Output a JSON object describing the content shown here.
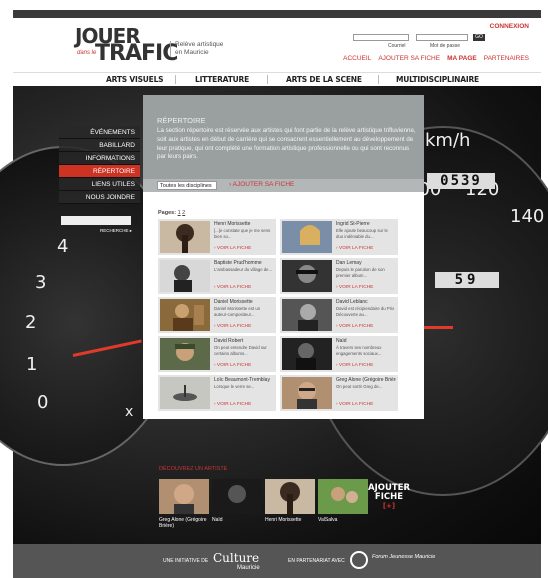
{
  "header": {
    "logo_top": "JOUER",
    "logo_small": "dans le",
    "logo_bottom": "TRAFIC",
    "tagline_1": "Relève artistique",
    "tagline_2": "en Mauricie",
    "connexion": "CONNEXION",
    "courriel_label": "Courriel",
    "password_label": "Mot de passe",
    "go_label": "GO",
    "nav": [
      "ACCUEIL",
      "AJOUTER SA FICHE",
      "MA PAGE",
      "PARTENAIRES"
    ]
  },
  "categories": [
    "ARTS VISUELS",
    "LITTERATURE",
    "ARTS DE LA SCENE",
    "MULTIDISCIPLINAIRE"
  ],
  "sidebar": {
    "items": [
      "ÉVÉNEMENTS",
      "BABILLARD",
      "INFORMATIONS",
      "RÉPERTOIRE",
      "LIENS UTILES",
      "NOUS JOINDRE"
    ],
    "active_index": 3,
    "search_label": "RECHERCHE ▸"
  },
  "dashboard": {
    "gauge_numbers_left": [
      "4",
      "3",
      "2",
      "1",
      "0"
    ],
    "gauge_numbers_right": [
      "100",
      "120",
      "140"
    ],
    "unit": "km/h",
    "odometer": "0539",
    "trip": "59",
    "x_label": "x"
  },
  "repertoire": {
    "title": "RÉPERTOIRE",
    "description": "La section répertoire est réservée aux artistes qui font partie de la relève artistique trifluvienne, soit aux artistes en début de carrière qui se consacrent essentiellement au développement de leur pratique, qui ont complété une formation artistique professionnelle ou qui sont reconnus par leurs pairs.",
    "filter_value": "Toutes les disciplines",
    "add_link": "› AJOUTER SA FICHE",
    "pages_label": "Pages:",
    "page_1": "1",
    "page_2": "2",
    "voir": "› VOIR LA FICHE",
    "artists": [
      {
        "name": "Henri Morissette",
        "bio": "[...]e constate que je me sens bien so..."
      },
      {
        "name": "Ingrid St-Pierre",
        "bio": "Elle ajoute beaucoup sur le duo indéniable du..."
      },
      {
        "name": "Baptiste Prud'homme",
        "bio": "L'ambassadeur du village de..."
      },
      {
        "name": "Dan Lemay",
        "bio": "Depuis le parution de son premier album..."
      },
      {
        "name": "Daniel Morissette",
        "bio": "Daniel Morissette est un auteur-compositeur..."
      },
      {
        "name": "David Leblanc",
        "bio": "David est récipiendaire du Prix Découverte au..."
      },
      {
        "name": "David Robert",
        "bio": "On peut entendre David sur certains albums..."
      },
      {
        "name": "Naïd",
        "bio": "À travers ses nombreux engagements sociaux..."
      },
      {
        "name": "Loïc Beaumont-Tremblay",
        "bio": "Lorsque le verre se..."
      },
      {
        "name": "Greg Alone (Grégoire Brière)",
        "bio": "On peut sortir Greg de..."
      }
    ]
  },
  "discover": {
    "title": "DÉCOUVREZ UN ARTISTE",
    "artists": [
      "Greg Alone (Grégoire Brière)",
      "Naïd",
      "Henri Morissette",
      "ValSalva"
    ],
    "ajouter_1": "AJOUTER",
    "ajouter_2": "FICHE",
    "ajouter_plus": "[+]"
  },
  "footer": {
    "initiative": "UNE INITIATIVE DE",
    "culture": "Culture",
    "mauricie": "Mauricie",
    "partner": "EN PARTENARIAT AVEC",
    "forum": "Forum Jeunesse Mauricie"
  },
  "colors": {
    "accent": "#cc3333",
    "dark": "#262626",
    "panel_grey": "#9aa0a0"
  }
}
